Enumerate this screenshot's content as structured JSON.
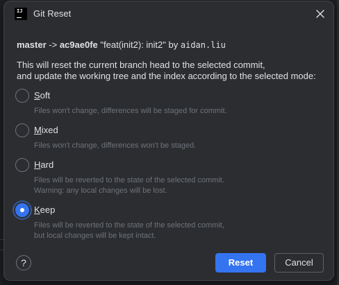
{
  "dialog": {
    "title": "Git Reset",
    "app_icon": "intellij-icon",
    "close_icon": "close-icon"
  },
  "commit": {
    "branch": "master",
    "arrow": "->",
    "hash": "ac9ae0fe",
    "message": "\"feat(init2): init2\"",
    "by": "by",
    "author": "aidan.liu"
  },
  "description": {
    "line1": "This will reset the current branch head to the selected commit,",
    "line2": "and update the working tree and the index according to the selected mode:"
  },
  "options": [
    {
      "mnemonic": "S",
      "rest": "oft",
      "selected": false,
      "hint1": "Files won't change, differences will be staged for commit.",
      "hint2": ""
    },
    {
      "mnemonic": "M",
      "rest": "ixed",
      "selected": false,
      "hint1": "Files won't change, differences won't be staged.",
      "hint2": ""
    },
    {
      "mnemonic": "H",
      "rest": "ard",
      "selected": false,
      "hint1": "Files will be reverted to the state of the selected commit.",
      "hint2": "Warning: any local changes will be lost."
    },
    {
      "mnemonic": "K",
      "rest": "eep",
      "selected": true,
      "hint1": "Files will be reverted to the state of the selected commit,",
      "hint2": "but local changes will be kept intact."
    }
  ],
  "footer": {
    "help_label": "?",
    "reset_label": "Reset",
    "cancel_label": "Cancel"
  },
  "colors": {
    "accent": "#3574f0",
    "dialog_bg": "#2b2d30",
    "hint_text": "#6f737a"
  }
}
